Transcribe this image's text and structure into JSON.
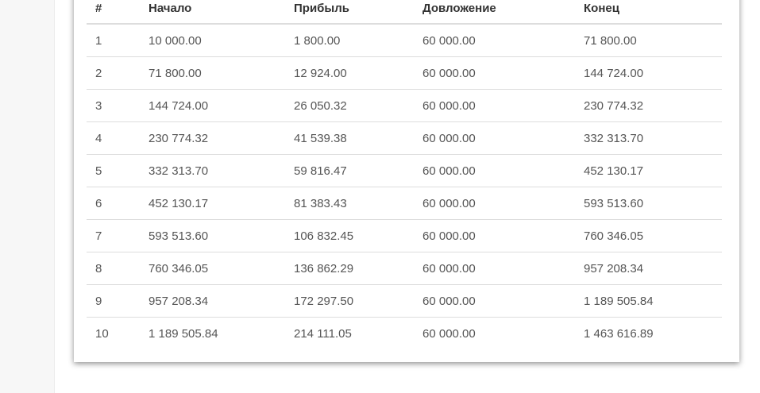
{
  "table": {
    "headers": [
      "#",
      "Начало",
      "Прибыль",
      "Довложение",
      "Конец"
    ],
    "rows": [
      [
        "1",
        "10 000.00",
        "1 800.00",
        "60 000.00",
        "71 800.00"
      ],
      [
        "2",
        "71 800.00",
        "12 924.00",
        "60 000.00",
        "144 724.00"
      ],
      [
        "3",
        "144 724.00",
        "26 050.32",
        "60 000.00",
        "230 774.32"
      ],
      [
        "4",
        "230 774.32",
        "41 539.38",
        "60 000.00",
        "332 313.70"
      ],
      [
        "5",
        "332 313.70",
        "59 816.47",
        "60 000.00",
        "452 130.17"
      ],
      [
        "6",
        "452 130.17",
        "81 383.43",
        "60 000.00",
        "593 513.60"
      ],
      [
        "7",
        "593 513.60",
        "106 832.45",
        "60 000.00",
        "760 346.05"
      ],
      [
        "8",
        "760 346.05",
        "136 862.29",
        "60 000.00",
        "957 208.34"
      ],
      [
        "9",
        "957 208.34",
        "172 297.50",
        "60 000.00",
        "1 189 505.84"
      ],
      [
        "10",
        "1 189 505.84",
        "214 111.05",
        "60 000.00",
        "1 463 616.89"
      ]
    ]
  }
}
